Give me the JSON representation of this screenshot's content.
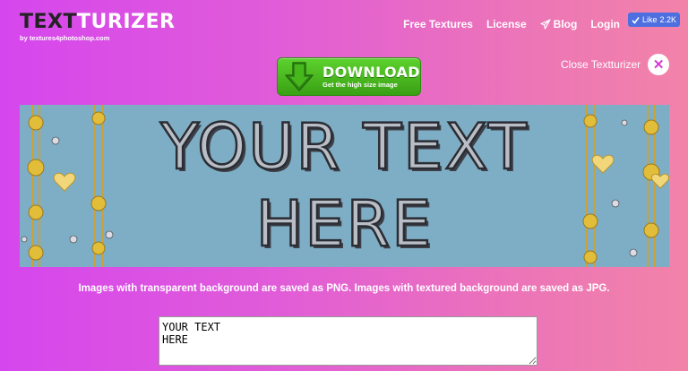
{
  "logo": {
    "part_dark": "TEXT",
    "part_light": "TURIZER",
    "subtitle": "by textures4photoshop.com"
  },
  "nav": {
    "items": [
      {
        "label": "Free Textures"
      },
      {
        "label": "License"
      },
      {
        "label": "Blog",
        "icon": "paper-plane-icon"
      },
      {
        "label": "Login"
      }
    ],
    "facebook_like": {
      "label": "Like",
      "count": "2.2K"
    }
  },
  "download": {
    "title": "DOWNLOAD",
    "subtitle": "Get the high size image",
    "icon": "download-arrow-icon"
  },
  "close": {
    "label": "Close Textturizer",
    "icon": "close-icon"
  },
  "preview": {
    "lines": [
      "YOUR TEXT",
      "HERE"
    ]
  },
  "info": {
    "message": "Images with transparent background are saved as PNG. Images with textured background are saved as JPG."
  },
  "text_input": {
    "value": "YOUR TEXT\nHERE"
  },
  "colors": {
    "bg_left": "#d646ee",
    "bg_right": "#f283a8",
    "button_green": "#4cc020",
    "preview_bg": "#7eaec6"
  }
}
